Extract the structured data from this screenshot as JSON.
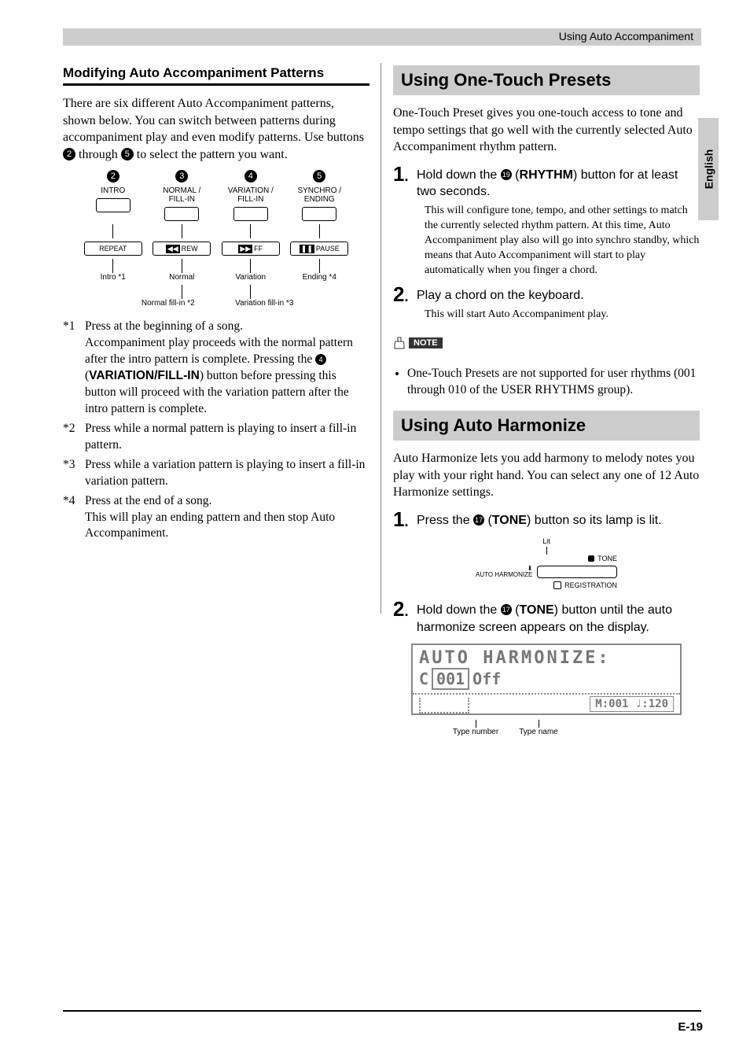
{
  "header": {
    "running": "Using Auto Accompaniment"
  },
  "sideTab": "English",
  "left": {
    "subheading": "Modifying Auto Accompaniment Patterns",
    "intro_a": "There are six different Auto Accompaniment patterns, shown below. You can switch between patterns during accompaniment play and even modify patterns. Use buttons ",
    "intro_b": " through ",
    "intro_c": " to select the pattern you want.",
    "b2": "2",
    "b5": "5",
    "b4": "4",
    "diagram": {
      "labels": [
        "INTRO",
        "NORMAL / FILL-IN",
        "VARIATION / FILL-IN",
        "SYNCHRO / ENDING"
      ],
      "keys_l": [
        "REPEAT",
        "REW",
        "FF",
        "PAUSE"
      ],
      "keys_icons": [
        "",
        "⏮",
        "⏭",
        "⏸"
      ],
      "row2": [
        "Intro *1",
        "Normal",
        "Variation",
        "Ending *4"
      ],
      "row3_a": "Normal fill-in *2",
      "row3_b": "Variation fill-in *3"
    },
    "notes": [
      {
        "tag": "*1",
        "text_a": "Press at the beginning of a song.",
        "text_b": "Accompaniment play proceeds with the normal pattern after the intro pattern is complete. Pressing the ",
        "btn": "4",
        "text_c": " (",
        "bold": "VARIATION/FILL-IN",
        "text_d": ") button before pressing this button will proceed with the variation pattern after the intro pattern is complete."
      },
      {
        "tag": "*2",
        "text": "Press while a normal pattern is playing to insert a fill-in pattern."
      },
      {
        "tag": "*3",
        "text": "Press while a variation pattern is playing to insert a fill-in variation pattern."
      },
      {
        "tag": "*4",
        "text_a": "Press at the end of a song.",
        "text_b": "This will play an ending pattern and then stop Auto Accompaniment."
      }
    ]
  },
  "right": {
    "sec1": {
      "title": "Using One-Touch Presets",
      "intro": "One-Touch Preset gives you one-touch access to tone and tempo settings that go well with the currently selected Auto Accompaniment rhythm pattern.",
      "step1_a": "Hold down the ",
      "step1_btn": "19",
      "step1_b": " (",
      "step1_bold": "RHYTHM",
      "step1_c": ") button for at least two seconds.",
      "step1_sub": "This will configure tone, tempo, and other settings to match the currently selected rhythm pattern. At this time, Auto Accompaniment play also will go into synchro standby, which means that Auto Accompaniment will start to play automatically when you finger a chord.",
      "step2": "Play a chord on the keyboard.",
      "step2_sub": "This will start Auto Accompaniment play.",
      "note_label": "NOTE",
      "note_text": "One-Touch Presets are not supported for user rhythms (001 through 010 of the USER RHYTHMS group)."
    },
    "sec2": {
      "title": "Using Auto Harmonize",
      "intro": "Auto Harmonize lets you add harmony to melody notes you play with your right hand. You can select any one of 12 Auto Harmonize settings.",
      "step1_a": "Press the ",
      "step1_btn": "17",
      "step1_b": " (",
      "step1_bold": "TONE",
      "step1_c": ") button so its lamp is lit.",
      "fig": {
        "lit": "Lit",
        "tone": "TONE",
        "auto": "AUTO HARMONIZE",
        "reg": "REGISTRATION"
      },
      "step2_a": "Hold down the ",
      "step2_btn": "17",
      "step2_b": " (",
      "step2_bold": "TONE",
      "step2_c": ") button until the auto harmonize screen appears on the display.",
      "lcd": {
        "r1": "AUTO  HARMONIZE:",
        "r2a": "C",
        "r2b": "001",
        "r2c": "Off",
        "bot": "M:001 ♩:120"
      },
      "lcd_lab_a": "Type number",
      "lcd_lab_b": "Type name"
    }
  },
  "pageNum": "E-19"
}
